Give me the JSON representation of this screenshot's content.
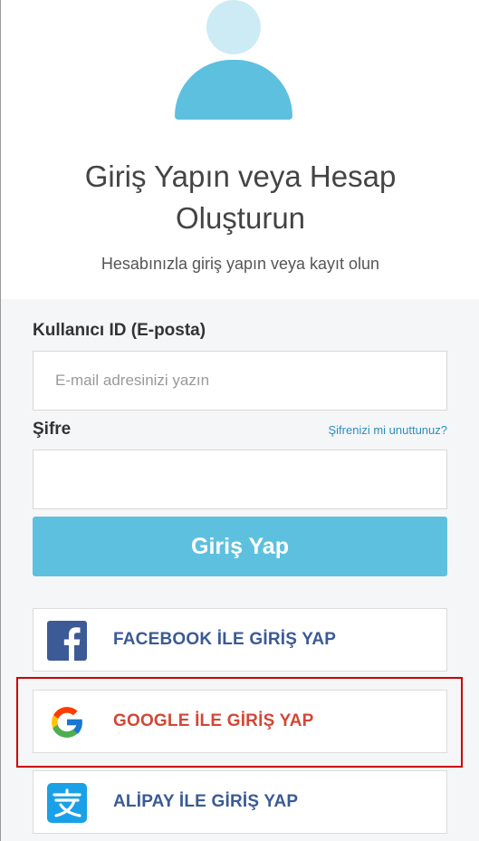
{
  "header": {
    "title_line1": "Giriş Yapın veya Hesap",
    "title_line2": "Oluşturun",
    "subtitle": "Hesabınızla giriş yapın veya kayıt olun"
  },
  "form": {
    "email_label": "Kullanıcı ID (E-posta)",
    "email_placeholder": "E-mail adresinizi yazın",
    "email_value": "",
    "password_label": "Şifre",
    "password_value": "",
    "forgot_link": "Şifrenizi mi unuttunuz?",
    "login_button": "Giriş Yap"
  },
  "social": {
    "facebook": "FACEBOOK İLE GİRİŞ YAP",
    "google": "GOOGLE İLE GİRİŞ YAP",
    "alipay": "ALİPAY İLE GİRİŞ YAP"
  },
  "colors": {
    "accent": "#5ec0df",
    "facebook": "#3b5a96",
    "google_text": "#d14836",
    "alipay": "#1aa0e6",
    "highlight": "#cc0000"
  },
  "icons": {
    "avatar": "user-avatar-icon",
    "facebook": "facebook-icon",
    "google": "google-icon",
    "alipay": "alipay-icon"
  }
}
